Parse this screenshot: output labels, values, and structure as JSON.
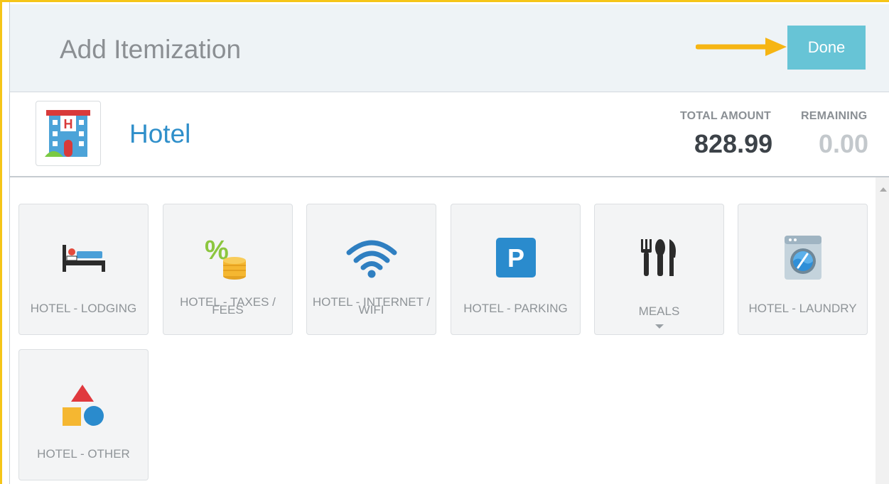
{
  "header": {
    "title": "Add Itemization",
    "done_label": "Done"
  },
  "expense_type": {
    "name": "Hotel",
    "icon": "hotel-building-icon",
    "total_amount_label": "TOTAL AMOUNT",
    "total_amount_value": "828.99",
    "remaining_label": "REMAINING",
    "remaining_value": "0.00"
  },
  "tiles": [
    {
      "label": "HOTEL - LODGING",
      "icon": "bed-icon"
    },
    {
      "label": "HOTEL - TAXES / FEES",
      "icon": "percent-coins-icon"
    },
    {
      "label": "HOTEL - INTERNET / WIFI",
      "icon": "wifi-icon"
    },
    {
      "label": "HOTEL - PARKING",
      "icon": "parking-icon"
    },
    {
      "label": "MEALS",
      "icon": "utensils-icon",
      "has_submenu": true
    },
    {
      "label": "HOTEL - LAUNDRY",
      "icon": "washing-machine-icon"
    },
    {
      "label": "HOTEL - OTHER",
      "icon": "shapes-icon"
    }
  ],
  "colors": {
    "accent": "#67c4d6",
    "highlight_border": "#f5c518",
    "arrow": "#f6b513",
    "type_name": "#2f8fca",
    "total_amount": "#3c4248",
    "remaining_amount": "#c3c8cc"
  }
}
